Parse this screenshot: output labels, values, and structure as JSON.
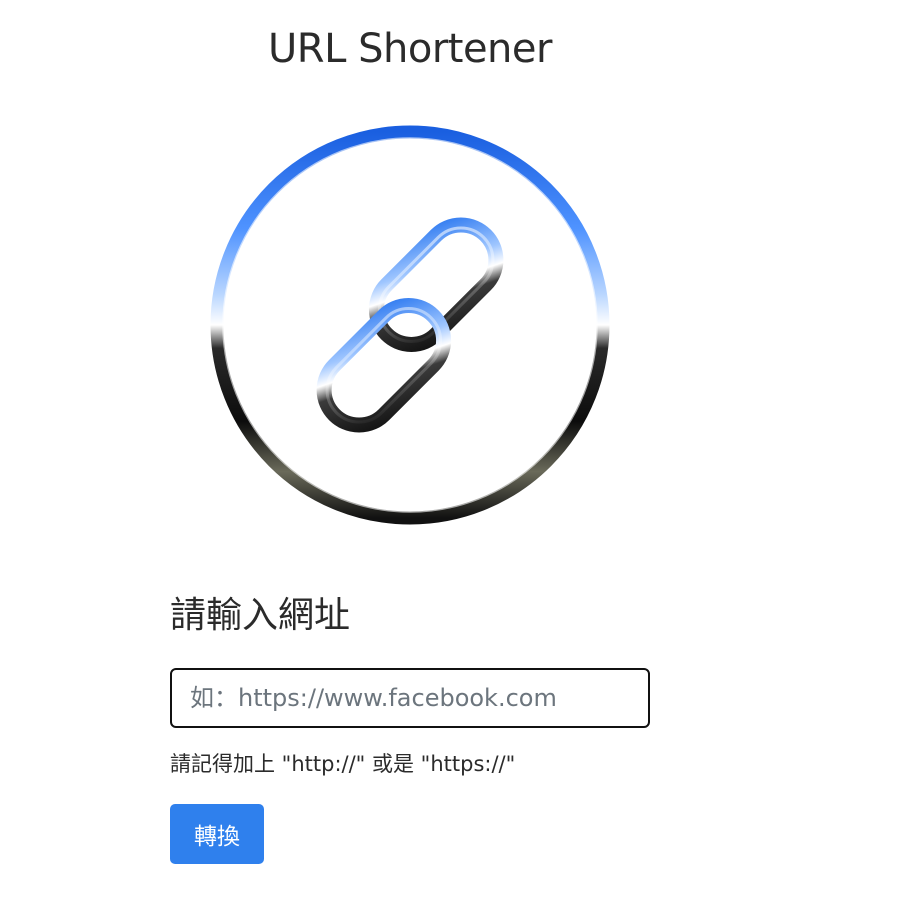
{
  "header": {
    "title": "URL Shortener"
  },
  "logo": {
    "icon": "link-chain-icon",
    "colors": {
      "top": "#2f7ff0",
      "bottom": "#111111"
    }
  },
  "form": {
    "label": "請輸入網址",
    "input_placeholder": "如：https://www.facebook.com",
    "input_value": "",
    "hint": "請記得加上 \"http://\" 或是 \"https://\"",
    "submit_label": "轉換"
  },
  "colors": {
    "button": "#2f80ed",
    "input_border": "#111111",
    "placeholder": "#6c757d"
  }
}
